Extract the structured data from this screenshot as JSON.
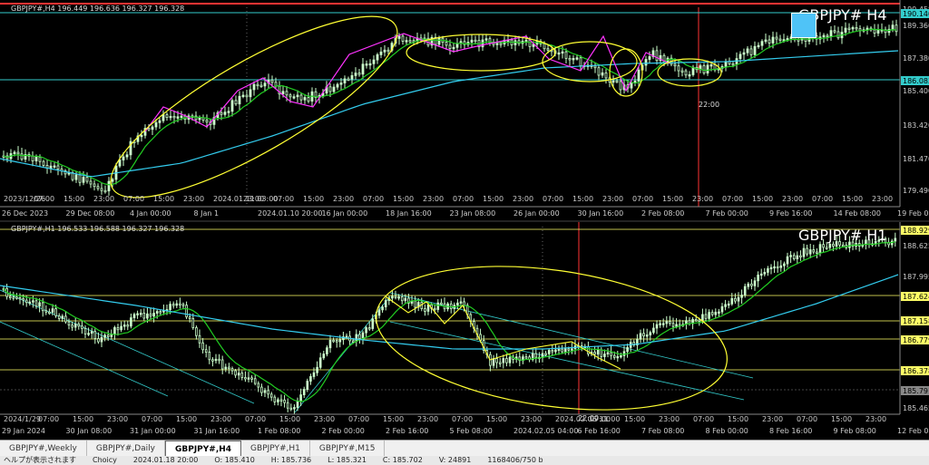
{
  "top_chart": {
    "header": "GBPJPY#,H4  196.449 196.636 196.327 196.328",
    "symbol": "GBPJPY# H4",
    "time_marker": "22:00",
    "date_labels": [
      "26 Dec 2023",
      "29 Dec 08:00",
      "4 Jan 00:00",
      "8 Jan 1",
      "2024.01.10 20:00",
      "16 Jan 00:00",
      "18 Jan 16:00",
      "23 Jan 08:00",
      "26 Jan 00:00",
      "30 Jan 16:00",
      "2 Feb 08:00",
      "7 Feb 00:00",
      "9 Feb 16:00",
      "14 Feb 08:00",
      "19 Feb 00"
    ],
    "hour_labels": [
      "2023/12/26",
      "07:00",
      "15:00",
      "23:00",
      "07:00",
      "15:00",
      "23:00",
      "2024.01.11 03:00",
      "23:00",
      "07:00",
      "15:00",
      "23:00",
      "07:00",
      "15:00",
      "23:00",
      "07:00",
      "15:00",
      "23:00",
      "07:00",
      "15:00",
      "23:00",
      "07:00",
      "15:00",
      "23:00",
      "07:00",
      "15:00",
      "23:00",
      "07:00",
      "15:00",
      "23:00"
    ],
    "price_labels": [
      "190.458",
      "189.360",
      "187.380",
      "185.400",
      "183.420",
      "181.470",
      "179.490"
    ],
    "price_tags": [
      "190.140",
      "186.083"
    ]
  },
  "bottom_chart": {
    "header": "GBPJPY#,H1  196.533 196.588 196.327 196.328",
    "symbol": "GBPJPY# H1",
    "time_marker": "22:00",
    "date_labels": [
      "29 Jan 2024",
      "30 Jan 08:00",
      "31 Jan 00:00",
      "31 Jan 16:00",
      "1 Feb 08:00",
      "2 Feb 00:00",
      "2 Feb 16:00",
      "5 Feb 08:00",
      "2024.02.05 04:00",
      "6 Feb 16:00",
      "7 Feb 08:00",
      "8 Feb 00:00",
      "8 Feb 16:00",
      "9 Feb 08:00",
      "12 Feb 00"
    ],
    "hour_labels": [
      "2024/1/29",
      "07:00",
      "15:00",
      "23:00",
      "07:00",
      "15:00",
      "23:00",
      "07:00",
      "15:00",
      "23:00",
      "07:00",
      "15:00",
      "23:00",
      "07:00",
      "15:00",
      "23:00",
      "2024.02.06 11:00",
      "07:00",
      "15:00",
      "23:00",
      "07:00",
      "15:00",
      "23:00",
      "07:00",
      "15:00",
      "23:00"
    ],
    "price_labels": [
      "188.929",
      "188.625",
      "187.995",
      "187.624",
      "187.158",
      "186.779",
      "186.378",
      "185.791",
      "185.465"
    ],
    "price_tags": [
      "188.929",
      "187.624",
      "187.158",
      "186.779",
      "186.378",
      "185.791"
    ]
  },
  "tabs": [
    "GBPJPY#,Weekly",
    "GBPJPY#,Daily",
    "GBPJPY#,H4",
    "GBPJPY#,H1",
    "GBPJPY#,M15"
  ],
  "active_tab": "GBPJPY#,H4",
  "status_bar": [
    "ヘルプが表示されます",
    "Choicy",
    "2024.01.18 20:00",
    "O: 185.410",
    "H: 185.736",
    "L: 185.321",
    "C: 185.702",
    "V: 24891",
    "1168406/750 b"
  ],
  "colors": {
    "candle": "#ccffcc",
    "ma_fast": "#22cc22",
    "ma_slow": "#33ccee",
    "annotation": "#ffff33",
    "zigzag": "#ff33ff",
    "marker": "#ff3333",
    "hline": "#ffff66"
  }
}
